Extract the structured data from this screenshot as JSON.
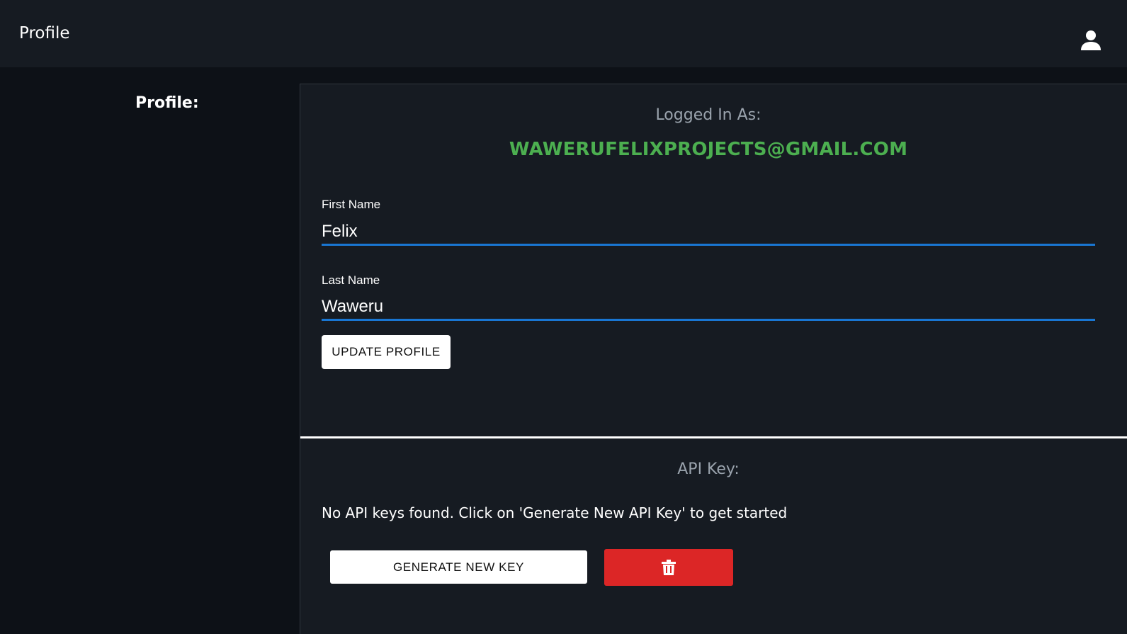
{
  "header": {
    "title": "Profile",
    "user_icon": "user-icon"
  },
  "sidebar": {
    "label": "Profile:"
  },
  "account": {
    "logged_in_label": "Logged In As:",
    "email": "WAWERUFELIXPROJECTS@GMAIL.COM",
    "email_color": "#4caf50"
  },
  "form": {
    "first_name_label": "First Name",
    "first_name_value": "Felix",
    "last_name_label": "Last Name",
    "last_name_value": "Waweru",
    "update_button": "UPDATE PROFILE",
    "underline_color": "#1976d2"
  },
  "api": {
    "label": "API Key:",
    "message": "No API keys found. Click on 'Generate New API Key' to get started",
    "generate_button": "GENERATE NEW KEY",
    "delete_icon": "trash-icon",
    "delete_color": "#dc2626"
  }
}
